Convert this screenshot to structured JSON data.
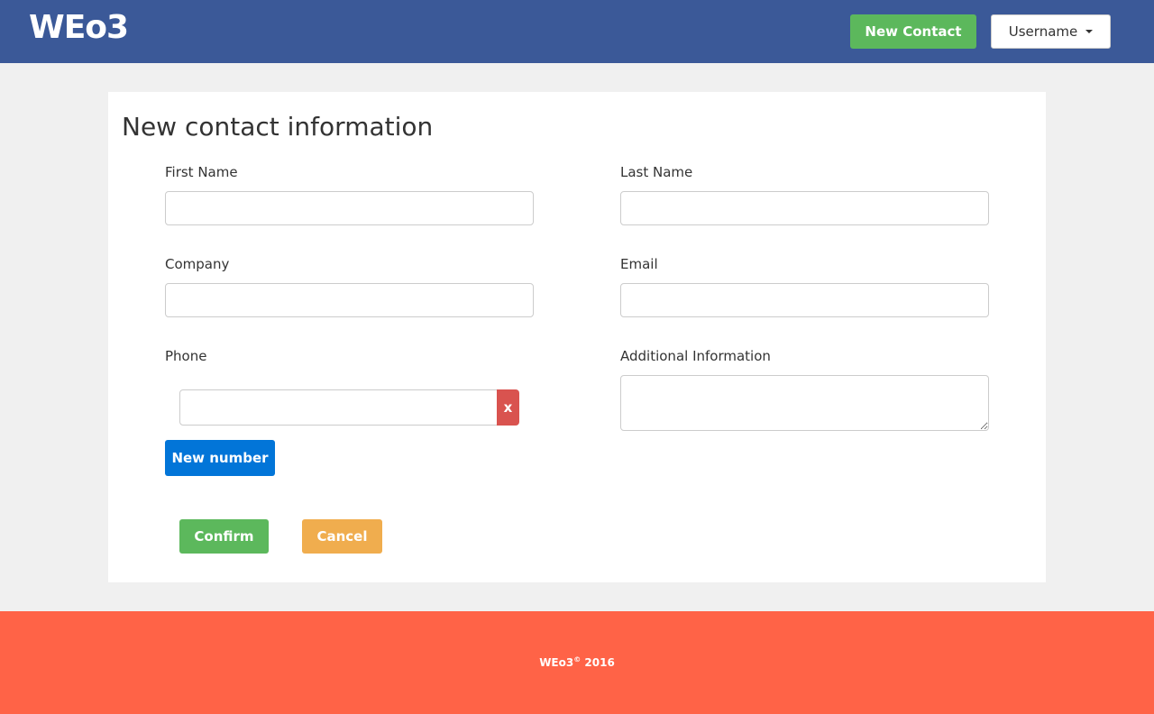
{
  "navbar": {
    "brand": "WEo3",
    "new_contact_label": "New Contact",
    "user_menu_label": "Username"
  },
  "form": {
    "title": "New contact information",
    "first_name": {
      "label": "First Name",
      "value": ""
    },
    "last_name": {
      "label": "Last Name",
      "value": ""
    },
    "company": {
      "label": "Company",
      "value": ""
    },
    "email": {
      "label": "Email",
      "value": ""
    },
    "phone": {
      "label": "Phone",
      "value": "",
      "remove_label": "x"
    },
    "additional_info": {
      "label": "Additional Information",
      "value": ""
    },
    "new_number_label": "New number",
    "confirm_label": "Confirm",
    "cancel_label": "Cancel"
  },
  "footer": {
    "brand": "WEo3",
    "copyright_symbol": "©",
    "year": "2016"
  },
  "colors": {
    "navbar": "#3b5998",
    "success": "#5cb85c",
    "primary": "#0275d8",
    "danger": "#d9534f",
    "warning": "#f0ad4e",
    "footer": "#ff6347",
    "background": "#f0f0f0"
  }
}
